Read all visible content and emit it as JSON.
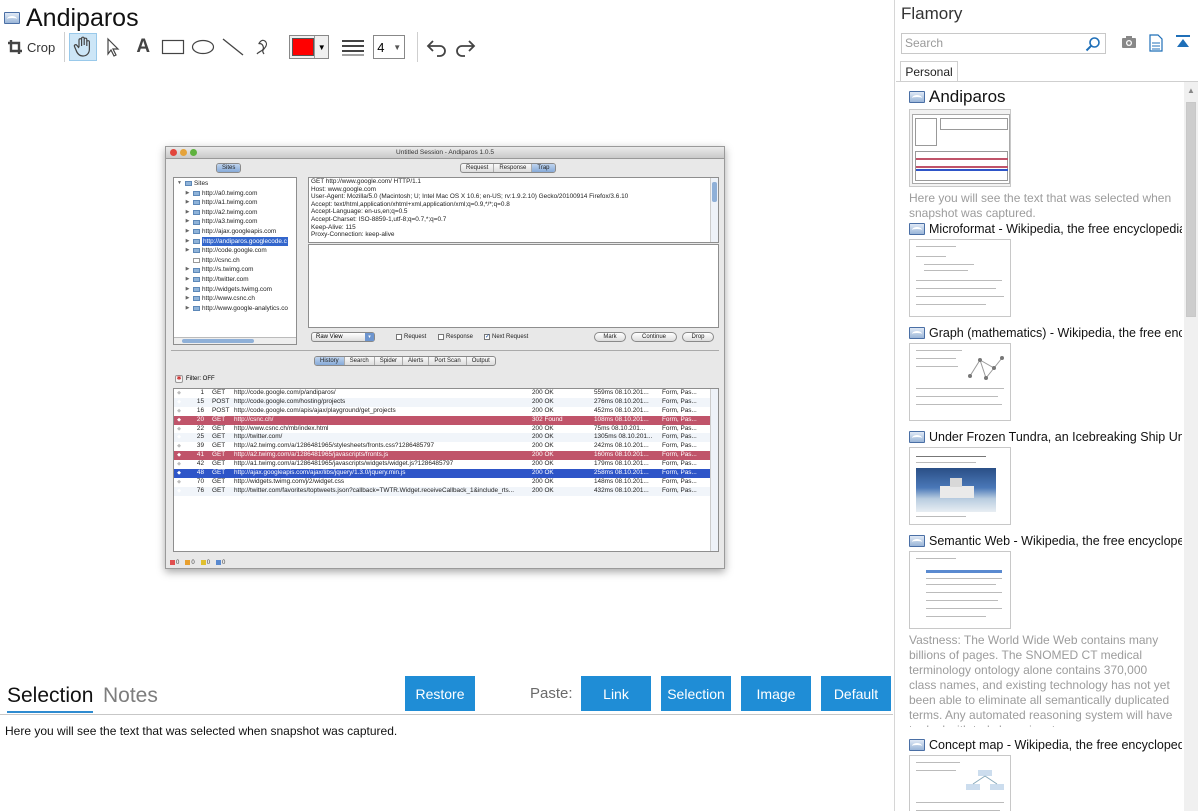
{
  "window": {
    "title": "Andiparos"
  },
  "toolbar": {
    "crop_label": "Crop",
    "line_width": "4"
  },
  "colors": {
    "accent": "#1f8dd6",
    "pen": "#ff0000"
  },
  "snapshot": {
    "window_title": "Untitled Session - Andiparos 1.0.5",
    "sites_tab": "Sites",
    "tabs_top": [
      "Request",
      "Response",
      "Trap"
    ],
    "tree_root": "Sites",
    "tree_items": [
      "http://a0.twimg.com",
      "http://a1.twimg.com",
      "http://a2.twimg.com",
      "http://a3.twimg.com",
      "http://ajax.googleapis.com",
      "http://andiparos.googlecode.c",
      "http://code.google.com",
      "http://csnc.ch",
      "http://s.twimg.com",
      "http://twitter.com",
      "http://widgets.twimg.com",
      "http://www.csnc.ch",
      "http://www.google-analytics.co"
    ],
    "request_lines": [
      "GET http://www.google.com/ HTTP/1.1",
      "Host: www.google.com",
      "User-Agent: Mozilla/5.0 (Macintosh; U; Intel Mac OS X 10.6; en-US; rv:1.9.2.10) Gecko/20100914 Firefox/3.6.10",
      "Accept: text/html,application/xhtml+xml,application/xml;q=0.9,*/*;q=0.8",
      "Accept-Language: en-us,en;q=0.5",
      "Accept-Charset: ISO-8859-1,utf-8;q=0.7,*;q=0.7",
      "Keep-Alive: 115",
      "Proxy-Connection: keep-alive"
    ],
    "view_select": "Raw View",
    "checks": {
      "request": "Request",
      "response": "Response",
      "next_request": "Next Request"
    },
    "buttons": {
      "mark": "Mark",
      "continue": "Continue",
      "drop": "Drop"
    },
    "tabs_bottom": [
      "History",
      "Search",
      "Spider",
      "Alerts",
      "Port Scan",
      "Output"
    ],
    "filter": "Filter: OFF",
    "history": [
      {
        "id": "1",
        "method": "GET",
        "url": "http://code.google.com/p/andiparos/",
        "status": "200 OK",
        "time": "559ms 08.10.201...",
        "type": "Form, Pas...",
        "style": ""
      },
      {
        "id": "15",
        "method": "POST",
        "url": "http://code.google.com/hosting/projects",
        "status": "200 OK",
        "time": "276ms 08.10.201...",
        "type": "Form, Pas...",
        "style": "alt"
      },
      {
        "id": "16",
        "method": "POST",
        "url": "http://code.google.com/apis/ajax/playground/get_projects",
        "status": "200 OK",
        "time": "452ms 08.10.201...",
        "type": "Form, Pas...",
        "style": ""
      },
      {
        "id": "20",
        "method": "GET",
        "url": "http://csnc.ch/",
        "status": "302 Found",
        "time": "108ms 08.10.201...",
        "type": "Form, Pas...",
        "style": "red"
      },
      {
        "id": "22",
        "method": "GET",
        "url": "http://www.csnc.ch/mb/index.html",
        "status": "200 OK",
        "time": "75ms 08.10.201...",
        "type": "Form, Pas...",
        "style": ""
      },
      {
        "id": "25",
        "method": "GET",
        "url": "http://twitter.com/",
        "status": "200 OK",
        "time": "1305ms 08.10.201...",
        "type": "Form, Pas...",
        "style": "alt"
      },
      {
        "id": "39",
        "method": "GET",
        "url": "http://a2.twimg.com/a/1286481965/stylesheets/fronts.css?1286485797",
        "status": "200 OK",
        "time": "242ms 08.10.201...",
        "type": "Form, Pas...",
        "style": ""
      },
      {
        "id": "41",
        "method": "GET",
        "url": "http://a2.twimg.com/a/1286481965/javascripts/fronts.js",
        "status": "200 OK",
        "time": "160ms 08.10.201...",
        "type": "Form, Pas...",
        "style": "red"
      },
      {
        "id": "42",
        "method": "GET",
        "url": "http://a1.twimg.com/a/1286481965/javascripts/widgets/widget.js?1286485797",
        "status": "200 OK",
        "time": "179ms 08.10.201...",
        "type": "Form, Pas...",
        "style": ""
      },
      {
        "id": "48",
        "method": "GET",
        "url": "http://ajax.googleapis.com/ajax/libs/jquery/1.3.0/jquery.min.js",
        "status": "200 OK",
        "time": "258ms 08.10.201...",
        "type": "Form, Pas...",
        "style": "blue"
      },
      {
        "id": "70",
        "method": "GET",
        "url": "http://widgets.twimg.com/j/2/widget.css",
        "status": "200 OK",
        "time": "148ms 08.10.201...",
        "type": "Form, Pas...",
        "style": ""
      },
      {
        "id": "76",
        "method": "GET",
        "url": "http://twitter.com/favorites/toptweets.json?callback=TWTR.Widget.receiveCallback_1&include_rts...",
        "status": "200 OK",
        "time": "432ms 08.10.201...",
        "type": "Form, Pas...",
        "style": "alt"
      }
    ],
    "status_counts": [
      "0",
      "0",
      "0",
      "0"
    ]
  },
  "bottom": {
    "tabs": [
      "Selection",
      "Notes"
    ],
    "restore_label": "Restore",
    "paste_label": "Paste:",
    "paste_buttons": [
      "Link",
      "Selection",
      "Image",
      "Default"
    ],
    "selection_text": "Here you will see the text that was selected when snapshot was captured."
  },
  "sidebar": {
    "title": "Flamory",
    "search_placeholder": "Search",
    "tab": "Personal",
    "entries": [
      {
        "title": "Andiparos",
        "desc": "Here you will see the text that was selected when snapshot was captured."
      },
      {
        "title": "Microformat - Wikipedia, the free encyclopedia",
        "desc": ""
      },
      {
        "title": "Graph (mathematics) - Wikipedia, the free ency",
        "desc": ""
      },
      {
        "title": "Under Frozen Tundra, an Icebreaking Ship Unco",
        "desc": ""
      },
      {
        "title": "Semantic Web - Wikipedia, the free encycloped",
        "desc": "Vastness: The World Wide Web contains many billions of pages. The SNOMED CT medical terminology ontology alone contains 370,000 class names, and existing technology has not yet been able to eliminate all semantically duplicated terms. Any automated reasoning system will have to deal with truly huge inputs."
      },
      {
        "title": "Concept map - Wikipedia, the free encyclopedia",
        "desc": ""
      }
    ]
  }
}
